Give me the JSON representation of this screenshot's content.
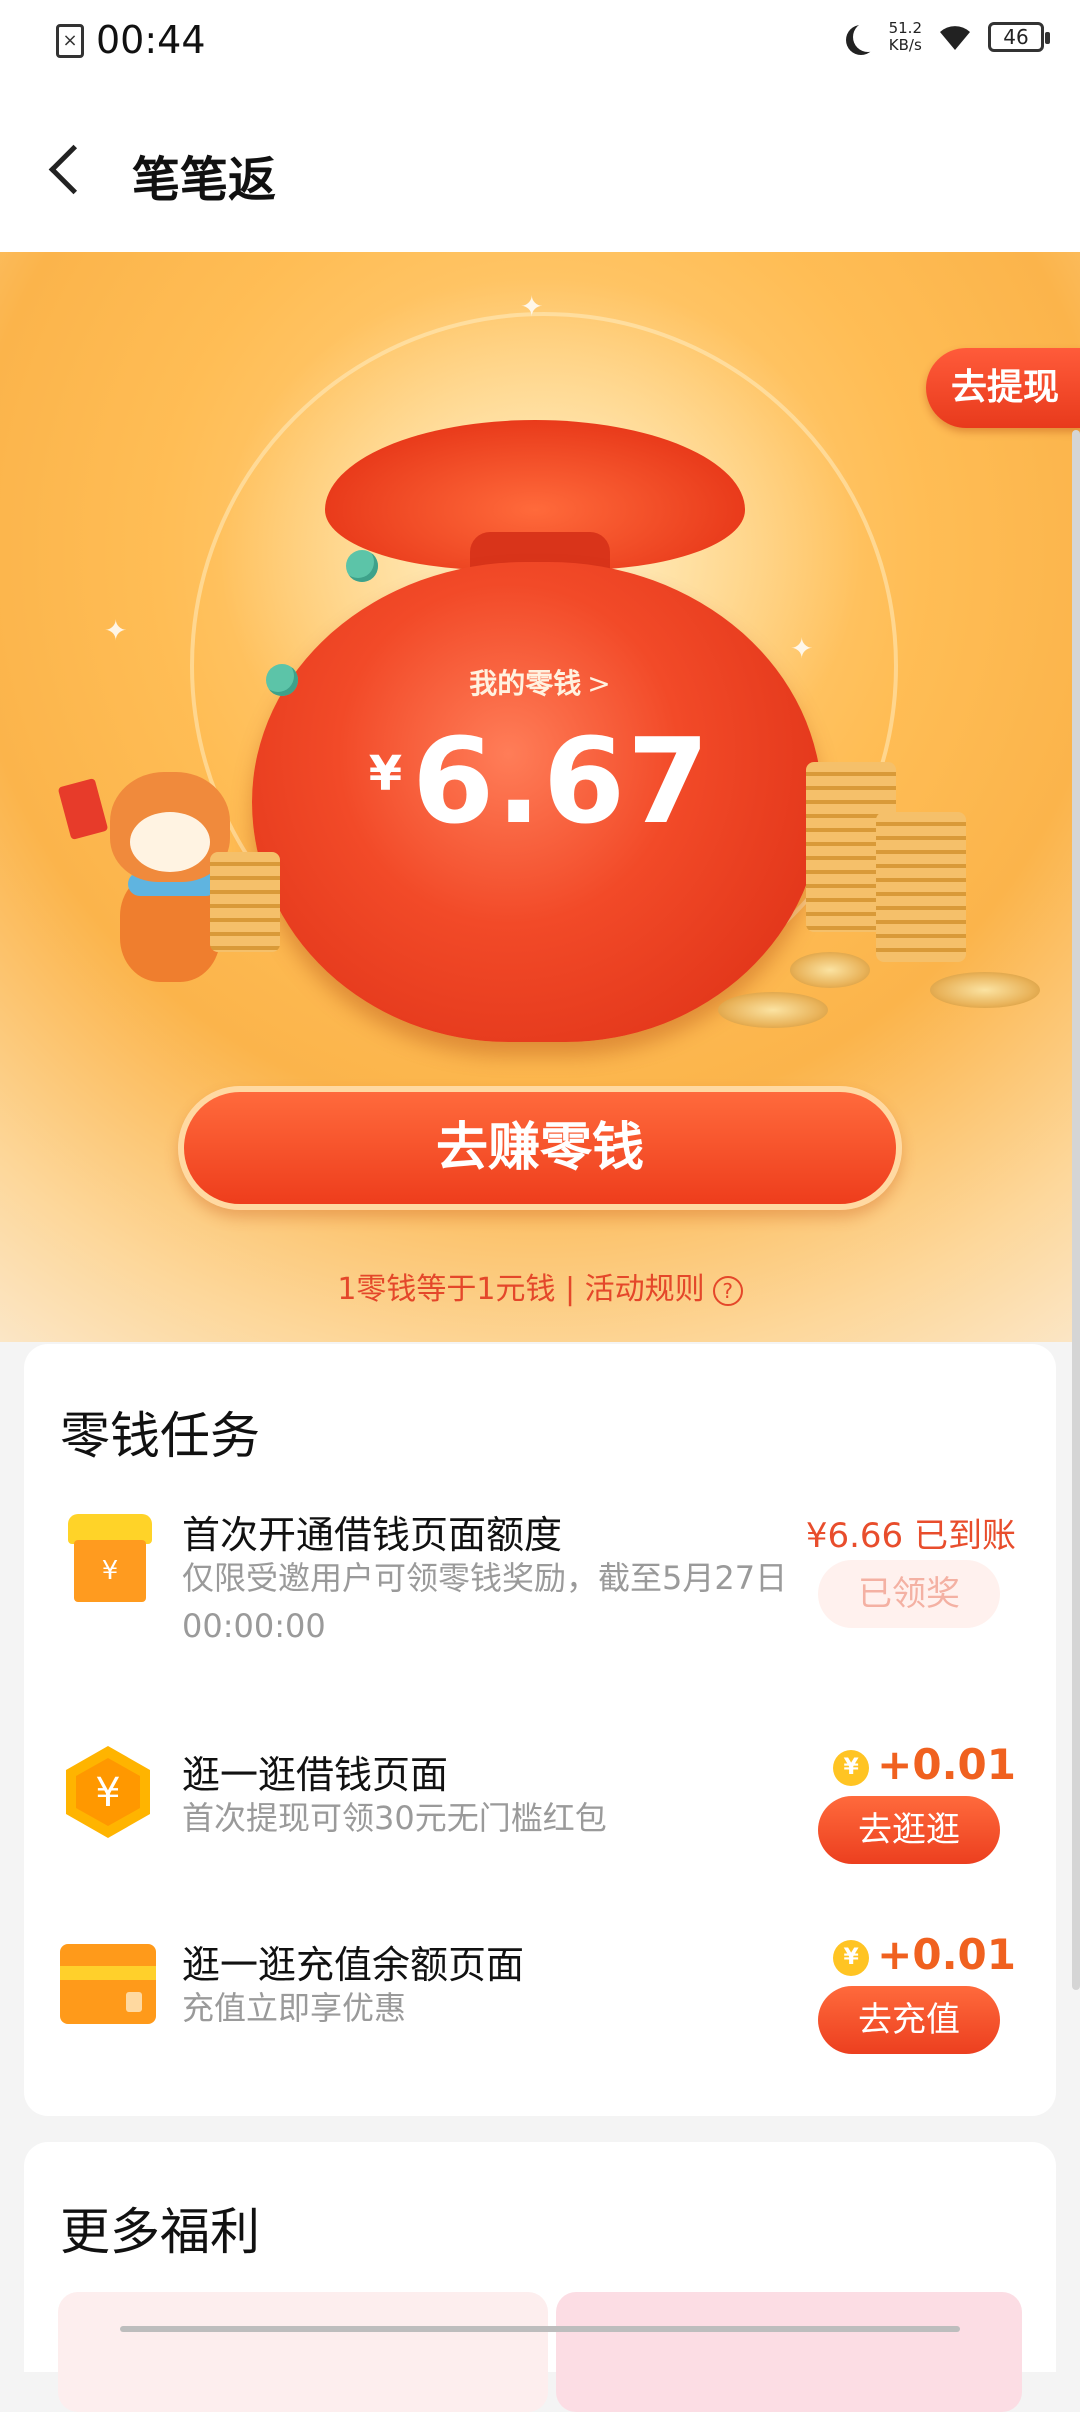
{
  "status_bar": {
    "time": "00:44",
    "network_speed_value": "51.2",
    "network_speed_unit": "KB/s",
    "battery": "46"
  },
  "header": {
    "title": "笔笔返"
  },
  "hero": {
    "withdraw_label": "去提现",
    "balance_label": "我的零钱",
    "balance_chevron": ">",
    "currency_symbol": "¥",
    "balance_value": "6.67",
    "earn_button_label": "去赚零钱",
    "rule_text": "1零钱等于1元钱 | 活动规则",
    "rule_help": "?"
  },
  "tasks": {
    "title": "零钱任务",
    "items": [
      {
        "name": "首次开通借钱页面额度",
        "desc": "仅限受邀用户可领零钱奖励，截至5月27日00:00:00",
        "reward": "¥6.66 已到账",
        "action": "已领奖",
        "icon": "shop-icon"
      },
      {
        "name": "逛一逛借钱页面",
        "desc": "首次提现可领30元无门槛红包",
        "reward": "+0.01",
        "action": "去逛逛",
        "icon": "yuan-hexagon-icon"
      },
      {
        "name": "逛一逛充值余额页面",
        "desc": "充值立即享优惠",
        "reward": "+0.01",
        "action": "去充值",
        "icon": "card-icon"
      }
    ]
  },
  "more": {
    "title": "更多福利"
  },
  "colors": {
    "accent": "#ee3d1c",
    "reward_orange": "#f0611f",
    "hero_bg": "#fbb44b"
  }
}
